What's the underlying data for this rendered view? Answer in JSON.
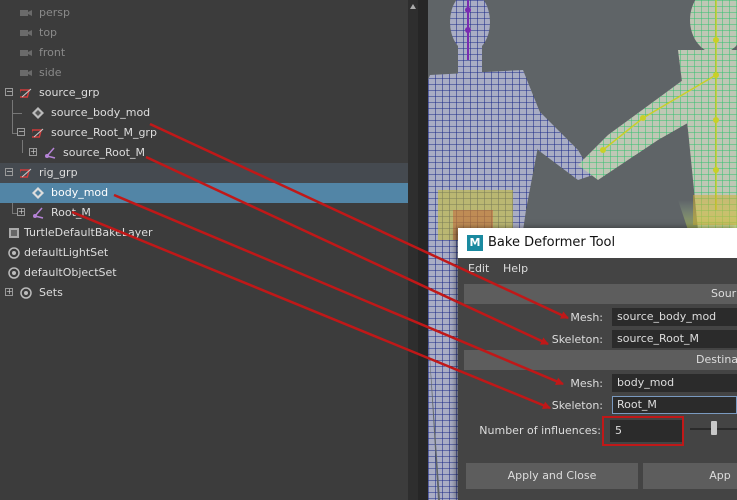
{
  "outliner": {
    "items": [
      {
        "label": "persp",
        "icon": "camera-icon"
      },
      {
        "label": "top",
        "icon": "camera-icon"
      },
      {
        "label": "front",
        "icon": "camera-icon"
      },
      {
        "label": "side",
        "icon": "camera-icon"
      },
      {
        "label": "source_grp",
        "icon": "group-icon"
      },
      {
        "label": "source_body_mod",
        "icon": "mesh-icon"
      },
      {
        "label": "source_Root_M_grp",
        "icon": "group-icon"
      },
      {
        "label": "source_Root_M",
        "icon": "joint-icon"
      },
      {
        "label": "rig_grp",
        "icon": "group-icon"
      },
      {
        "label": "body_mod",
        "icon": "mesh-icon"
      },
      {
        "label": "Root_M",
        "icon": "joint-icon"
      },
      {
        "label": "TurtleDefaultBakeLayer",
        "icon": "bake-layer-icon"
      },
      {
        "label": "defaultLightSet",
        "icon": "set-icon"
      },
      {
        "label": "defaultObjectSet",
        "icon": "set-icon"
      },
      {
        "label": "Sets",
        "icon": "sets-icon"
      }
    ]
  },
  "dialog": {
    "logo": "M",
    "title": "Bake Deformer Tool",
    "menu": [
      "Edit",
      "Help"
    ],
    "source_section": "Sour",
    "destination_section": "Destina",
    "mesh_label": "Mesh:",
    "skeleton_label": "Skeleton:",
    "source_mesh": "source_body_mod",
    "source_skeleton": "source_Root_M",
    "dest_mesh": "body_mod",
    "dest_skeleton": "Root_M",
    "influences_label": "Number of influences:",
    "influences": "5",
    "apply_close": "Apply and Close",
    "apply": "App"
  },
  "colors": {
    "annotation": "#c01818",
    "selection": "#5285a6",
    "group_row": "#454a50"
  }
}
